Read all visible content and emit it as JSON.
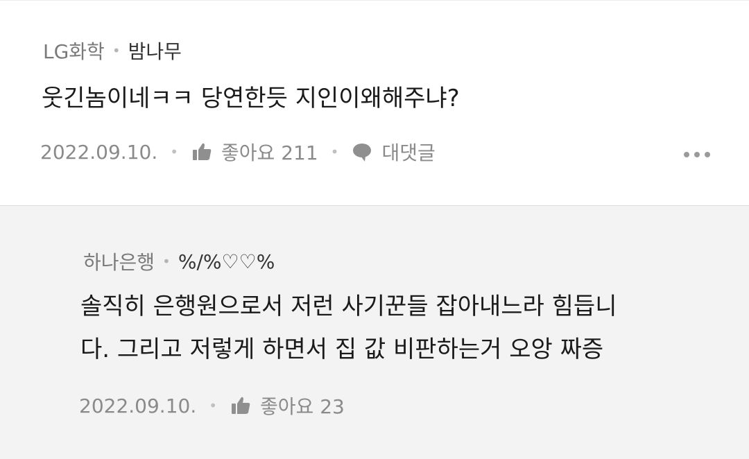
{
  "comments": [
    {
      "author": "LG화학",
      "nickname": "밤나무",
      "text": "웃긴놈이네ㅋㅋ 당연한듯 지인이왜해주냐?",
      "date": "2022.09.10.",
      "likes_label": "좋아요 211",
      "reply_label": "대댓글",
      "like_icon": "thumbs-up-icon",
      "reply_icon": "speech-bubble-icon",
      "more_icon": "more-dots-icon"
    },
    {
      "author": "하나은행",
      "nickname": "%/%♡♡%",
      "text_line1": "솔직히 은행원으로서 저런 사기꾼들 잡아내느라 힘듭니",
      "text_line2": "다. 그리고 저렇게 하면서 집 값 비판하는거 오앙 짜증",
      "date": "2022.09.10.",
      "likes_label": "좋아요 23",
      "like_icon": "thumbs-up-icon"
    }
  ],
  "colors": {
    "reply_background": "#f3f3f3",
    "text": "#1a1a1a",
    "muted": "#8a8a8a"
  }
}
